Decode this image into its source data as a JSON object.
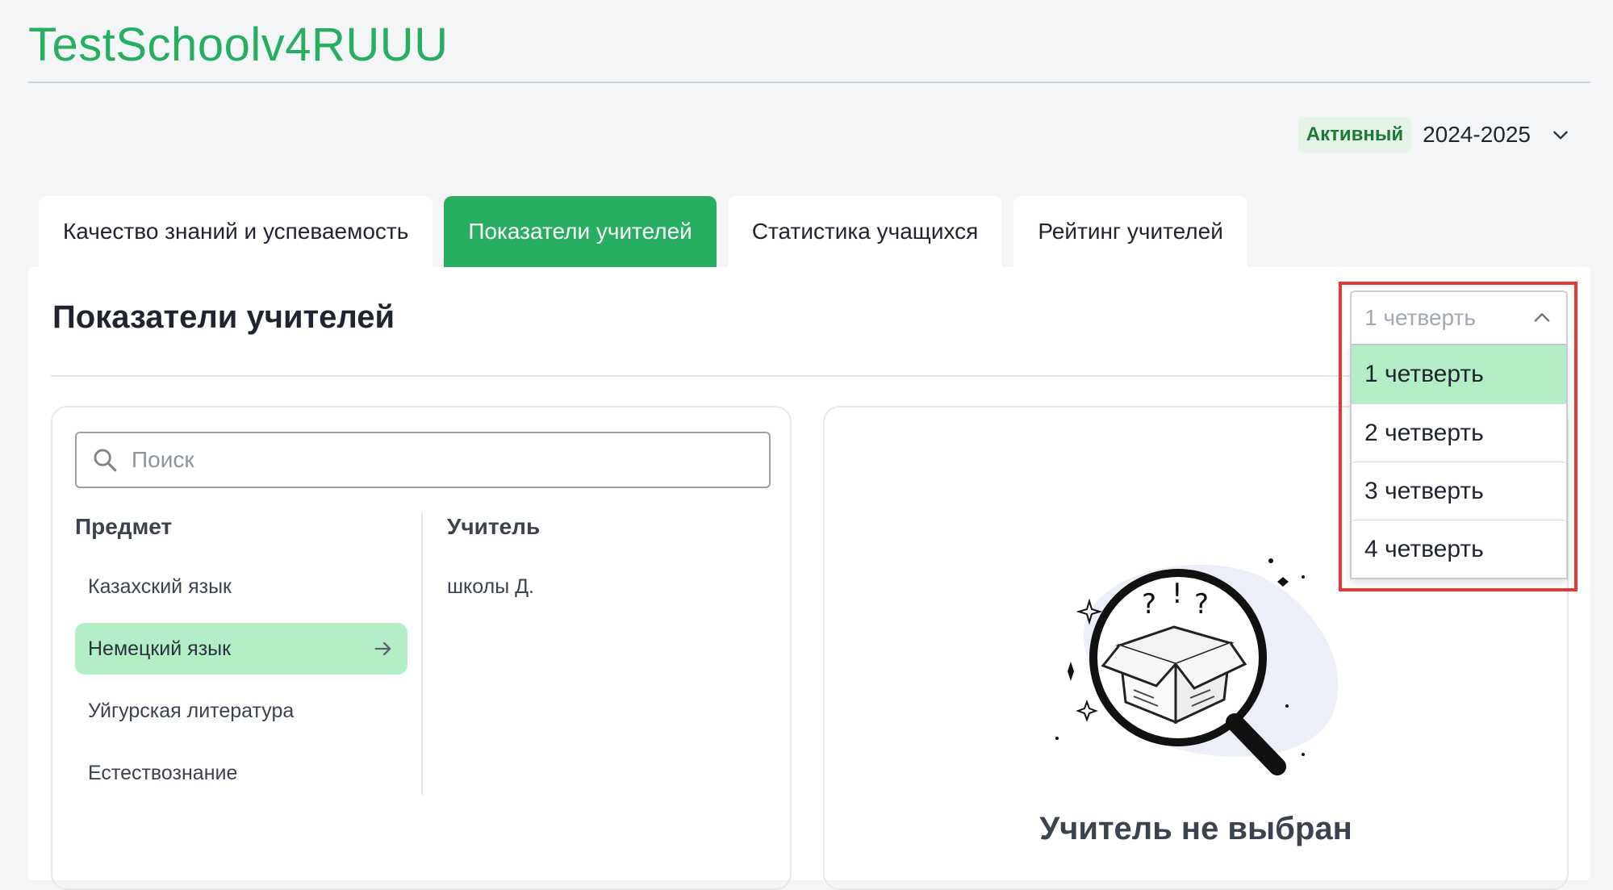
{
  "header": {
    "school_name": "TestSchoolv4RUUU",
    "status_badge": "Активный",
    "academic_year": "2024-2025"
  },
  "tabs": [
    {
      "label": "Качество знаний и успеваемость",
      "active": false
    },
    {
      "label": "Показатели учителей",
      "active": true
    },
    {
      "label": "Статистика учащихся",
      "active": false
    },
    {
      "label": "Рейтинг учителей",
      "active": false
    }
  ],
  "panel": {
    "title": "Показатели учителей"
  },
  "search": {
    "placeholder": "Поиск",
    "value": ""
  },
  "subjects": {
    "header": "Предмет",
    "items": [
      {
        "label": "Казахский язык",
        "selected": false
      },
      {
        "label": "Немецкий язык",
        "selected": true
      },
      {
        "label": "Уйгурская литература",
        "selected": false
      },
      {
        "label": "Естествознание",
        "selected": false
      }
    ]
  },
  "teachers": {
    "header": "Учитель",
    "items": [
      {
        "label": "школы Д."
      }
    ]
  },
  "empty_state": {
    "message": "Учитель не выбран"
  },
  "quarter_dropdown": {
    "selected": "1 четверть",
    "options": [
      "1 четверть",
      "2 четверть",
      "3 четверть",
      "4 четверть"
    ],
    "open": true
  },
  "colors": {
    "accent": "#27ae60",
    "selected_bg": "#b3eec6",
    "badge_bg": "#e6f3e7",
    "badge_text": "#1b7a37",
    "highlight": "#e53935"
  },
  "icons": {
    "year_dropdown": "chevron-down-icon",
    "search": "search-icon",
    "selected_subject": "arrow-right-icon",
    "dropdown_toggle": "chevron-up-icon"
  }
}
